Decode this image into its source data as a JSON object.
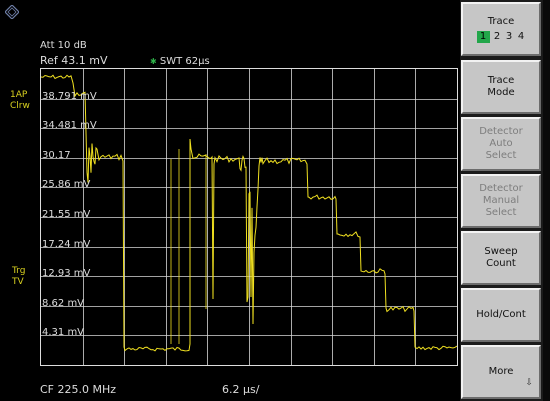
{
  "header": {
    "att": "Att  10 dB",
    "ref": "Ref  43.1 mV",
    "swt": "SWT 62µs",
    "trace_mode_flag": "1AP\nClrw",
    "trigger_flag": "Trg\nTV"
  },
  "axis": {
    "y_labels": [
      "38.791 mV",
      "34.481 mV",
      "30.17",
      "25.86 mV",
      "21.55 mV",
      "17.24 mV",
      "12.93 mV",
      "8.62 mV",
      "4.31 mV"
    ]
  },
  "footer": {
    "center_freq": "CF 225.0 MHz",
    "sweep_div": "6.2 µs/"
  },
  "softkeys": [
    {
      "line1": "Trace",
      "line2": "",
      "line3": "",
      "enabled": true,
      "has_nums": true
    },
    {
      "line1": "Trace",
      "line2": "Mode",
      "line3": "",
      "enabled": true
    },
    {
      "line1": "Detector",
      "line2": "Auto",
      "line3": "Select",
      "enabled": false
    },
    {
      "line1": "Detector",
      "line2": "Manual",
      "line3": "Select",
      "enabled": false
    },
    {
      "line1": "Sweep",
      "line2": "Count",
      "line3": "",
      "enabled": true
    },
    {
      "line1": "Hold/Cont",
      "line2": "",
      "line3": "",
      "enabled": true
    },
    {
      "line1": "More",
      "line2": "",
      "line3": "",
      "enabled": true
    }
  ],
  "trace_numbers": [
    "1",
    "2",
    "3",
    "4"
  ],
  "active_trace": "1",
  "colors": {
    "trace": "#f0e020",
    "grid": "#d8d8d8",
    "trace_select": "#22a64a"
  }
}
